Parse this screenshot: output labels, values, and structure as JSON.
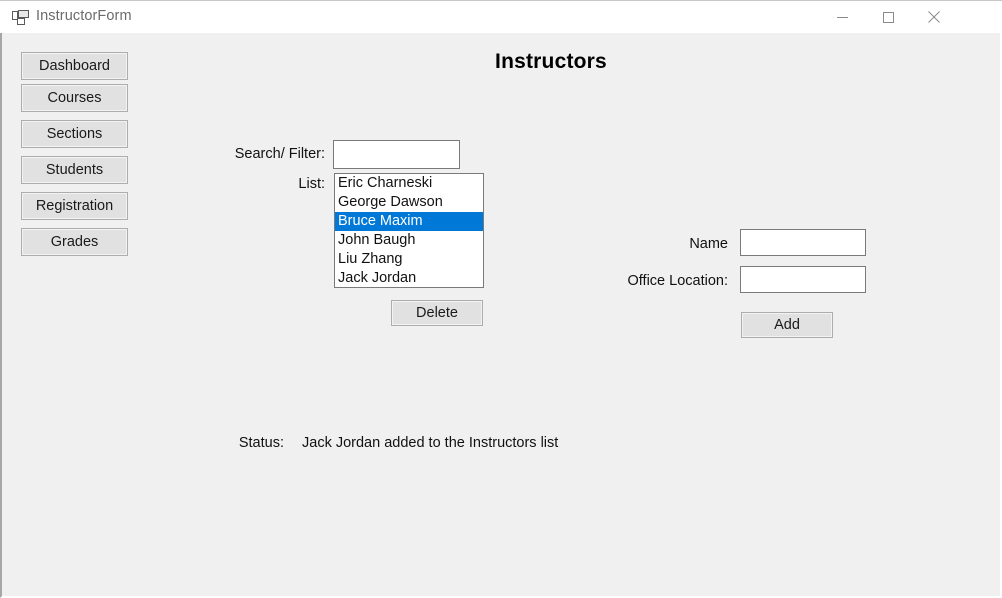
{
  "window": {
    "title": "InstructorForm",
    "icon": "windows-forms-icon",
    "controls": {
      "minimize": "minimize-icon",
      "maximize": "maximize-icon",
      "close": "close-icon"
    }
  },
  "sidebar": {
    "items": [
      {
        "label": "Dashboard"
      },
      {
        "label": "Courses"
      },
      {
        "label": "Sections"
      },
      {
        "label": "Students"
      },
      {
        "label": "Registration"
      },
      {
        "label": "Grades"
      }
    ]
  },
  "main": {
    "heading": "Instructors",
    "search": {
      "label": "Search/ Filter:",
      "value": "",
      "placeholder": ""
    },
    "list": {
      "label": "List:",
      "items": [
        {
          "label": "Eric Charneski",
          "selected": false
        },
        {
          "label": "George Dawson",
          "selected": false
        },
        {
          "label": "Bruce Maxim",
          "selected": true
        },
        {
          "label": "John Baugh",
          "selected": false
        },
        {
          "label": "Liu Zhang",
          "selected": false
        },
        {
          "label": "Jack Jordan",
          "selected": false
        }
      ]
    },
    "delete_button": "Delete",
    "name_field": {
      "label": "Name",
      "value": "",
      "placeholder": ""
    },
    "office_field": {
      "label": "Office Location:",
      "value": "",
      "placeholder": ""
    },
    "add_button": "Add",
    "status": {
      "label": "Status:",
      "message": "Jack Jordan added to the Instructors list"
    }
  },
  "colors": {
    "selection": "#0078d7",
    "window_background": "#f0f0f0",
    "titlebar_background": "#ffffff",
    "button_face": "#e1e1e1",
    "control_border": "#7a7a7a"
  }
}
